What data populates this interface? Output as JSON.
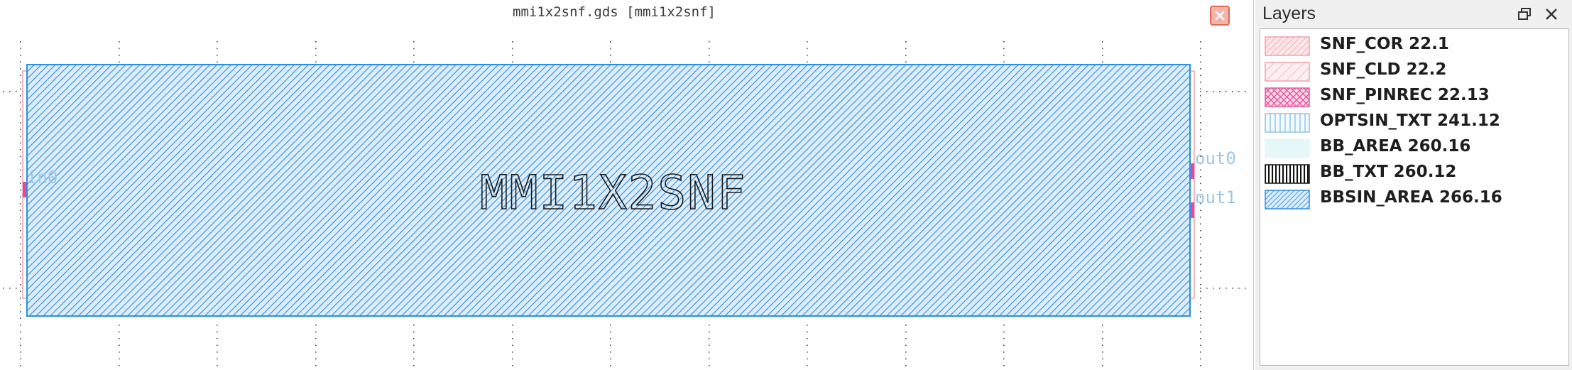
{
  "canvas": {
    "title": "mmi1x2snf.gds [mmi1x2snf]",
    "cell_label": "MMI1X2SNF",
    "ports": [
      {
        "name": "in0",
        "label": "in0"
      },
      {
        "name": "out0",
        "label": "out0"
      },
      {
        "name": "out1",
        "label": "out1"
      }
    ],
    "close_icon": "close-icon"
  },
  "layers_panel": {
    "title": "Layers",
    "float_icon": "float-window-icon",
    "close_icon": "close-icon",
    "layers": [
      {
        "label": "SNF_COR 22.1",
        "color": "#f2a0a8",
        "pattern": "hatch-fine"
      },
      {
        "label": "SNF_CLD 22.2",
        "color": "#f2a0a8",
        "pattern": "hatch-sparse"
      },
      {
        "label": "SNF_PINREC 22.13",
        "color": "#e8559a",
        "pattern": "crosshatch"
      },
      {
        "label": "OPTSIN_TXT 241.12",
        "color": "#8fc4e6",
        "pattern": "vertical-sparse"
      },
      {
        "label": "BB_AREA 260.16",
        "color": "#dff4f7",
        "pattern": "solid-light"
      },
      {
        "label": "BB_TXT 260.12",
        "color": "#111111",
        "pattern": "vertical-dense"
      },
      {
        "label": "BBSIN_AREA 266.16",
        "color": "#2e8fe0",
        "pattern": "hatch-dense"
      }
    ]
  }
}
